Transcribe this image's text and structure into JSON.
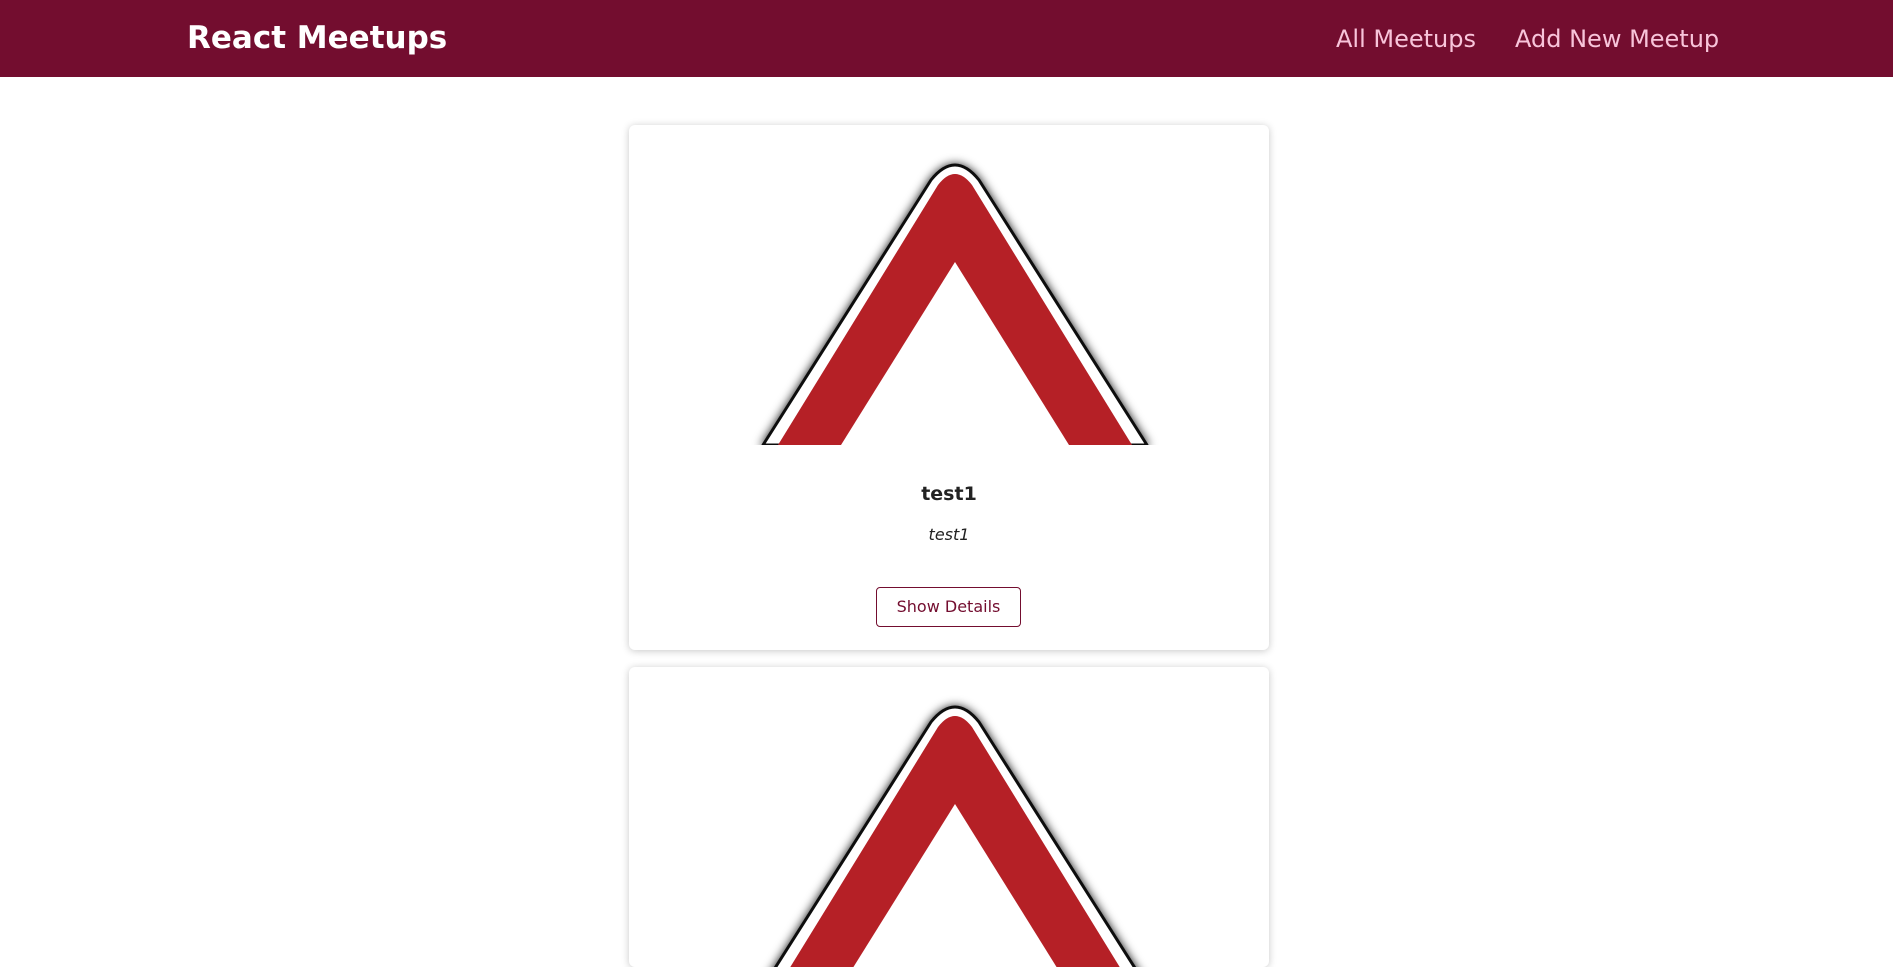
{
  "header": {
    "logo": "React Meetups",
    "nav": {
      "all_meetups": "All Meetups",
      "add_new_meetup": "Add New Meetup"
    }
  },
  "colors": {
    "header_bg": "#730d2f",
    "nav_link": "#f8c4da",
    "accent": "#730d2f",
    "sign_red": "#b52026"
  },
  "meetups": [
    {
      "image_icon": "warning-triangle-sign-icon",
      "title": "test1",
      "address": "test1",
      "button_label": "Show Details"
    },
    {
      "image_icon": "warning-triangle-sign-icon"
    }
  ]
}
